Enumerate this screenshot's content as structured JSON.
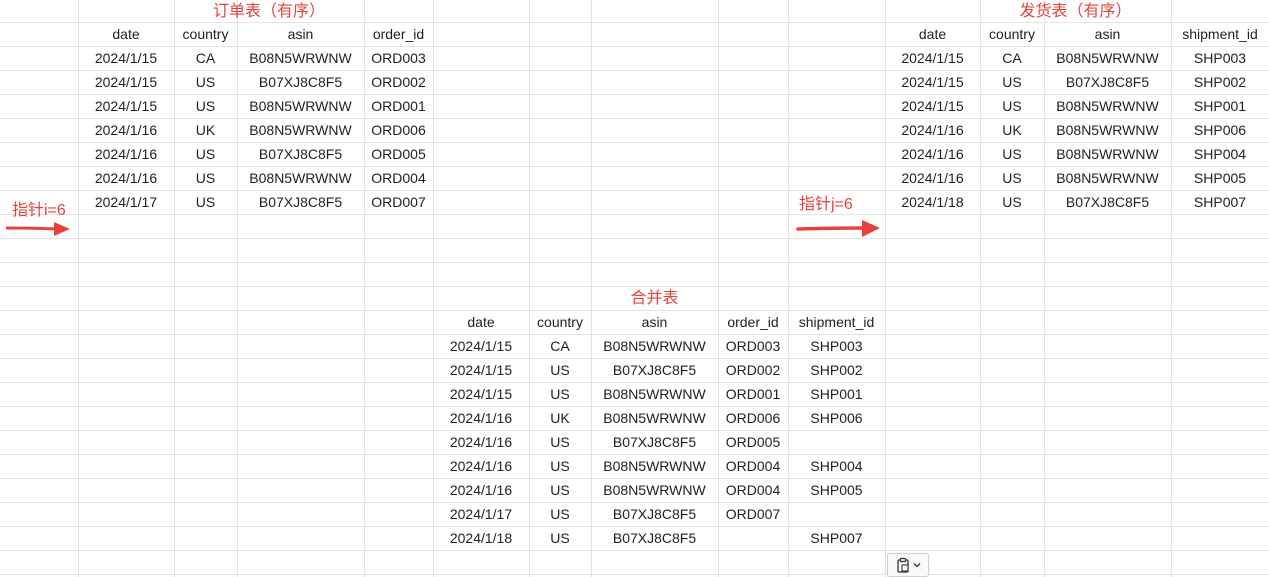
{
  "orders": {
    "title": "订单表（有序）",
    "headers": [
      "date",
      "country",
      "asin",
      "order_id"
    ],
    "rows": [
      [
        "2024/1/15",
        "CA",
        "B08N5WRWNW",
        "ORD003"
      ],
      [
        "2024/1/15",
        "US",
        "B07XJ8C8F5",
        "ORD002"
      ],
      [
        "2024/1/15",
        "US",
        "B08N5WRWNW",
        "ORD001"
      ],
      [
        "2024/1/16",
        "UK",
        "B08N5WRWNW",
        "ORD006"
      ],
      [
        "2024/1/16",
        "US",
        "B07XJ8C8F5",
        "ORD005"
      ],
      [
        "2024/1/16",
        "US",
        "B08N5WRWNW",
        "ORD004"
      ],
      [
        "2024/1/17",
        "US",
        "B07XJ8C8F5",
        "ORD007"
      ]
    ],
    "pointer_label": "指针i=6"
  },
  "shipments": {
    "title": "发货表（有序）",
    "headers": [
      "date",
      "country",
      "asin",
      "shipment_id"
    ],
    "rows": [
      [
        "2024/1/15",
        "CA",
        "B08N5WRWNW",
        "SHP003"
      ],
      [
        "2024/1/15",
        "US",
        "B07XJ8C8F5",
        "SHP002"
      ],
      [
        "2024/1/15",
        "US",
        "B08N5WRWNW",
        "SHP001"
      ],
      [
        "2024/1/16",
        "UK",
        "B08N5WRWNW",
        "SHP006"
      ],
      [
        "2024/1/16",
        "US",
        "B08N5WRWNW",
        "SHP004"
      ],
      [
        "2024/1/16",
        "US",
        "B08N5WRWNW",
        "SHP005"
      ],
      [
        "2024/1/18",
        "US",
        "B07XJ8C8F5",
        "SHP007"
      ]
    ],
    "pointer_label": "指针j=6"
  },
  "merged": {
    "title": "合并表",
    "headers": [
      "date",
      "country",
      "asin",
      "order_id",
      "shipment_id"
    ],
    "rows": [
      [
        "2024/1/15",
        "CA",
        "B08N5WRWNW",
        "ORD003",
        "SHP003"
      ],
      [
        "2024/1/15",
        "US",
        "B07XJ8C8F5",
        "ORD002",
        "SHP002"
      ],
      [
        "2024/1/15",
        "US",
        "B08N5WRWNW",
        "ORD001",
        "SHP001"
      ],
      [
        "2024/1/16",
        "UK",
        "B08N5WRWNW",
        "ORD006",
        "SHP006"
      ],
      [
        "2024/1/16",
        "US",
        "B07XJ8C8F5",
        "ORD005",
        ""
      ],
      [
        "2024/1/16",
        "US",
        "B08N5WRWNW",
        "ORD004",
        "SHP004"
      ],
      [
        "2024/1/16",
        "US",
        "B08N5WRWNW",
        "ORD004",
        "SHP005"
      ],
      [
        "2024/1/17",
        "US",
        "B07XJ8C8F5",
        "ORD007",
        ""
      ],
      [
        "2024/1/18",
        "US",
        "B07XJ8C8F5",
        "",
        "SHP007"
      ]
    ]
  },
  "colors": {
    "accent": "#e8413b",
    "gridline": "#e3e3e3",
    "text": "#1f1f1f"
  },
  "paste_options": {
    "icon": "clipboard-icon",
    "dropdown_icon": "chevron-down-icon"
  }
}
